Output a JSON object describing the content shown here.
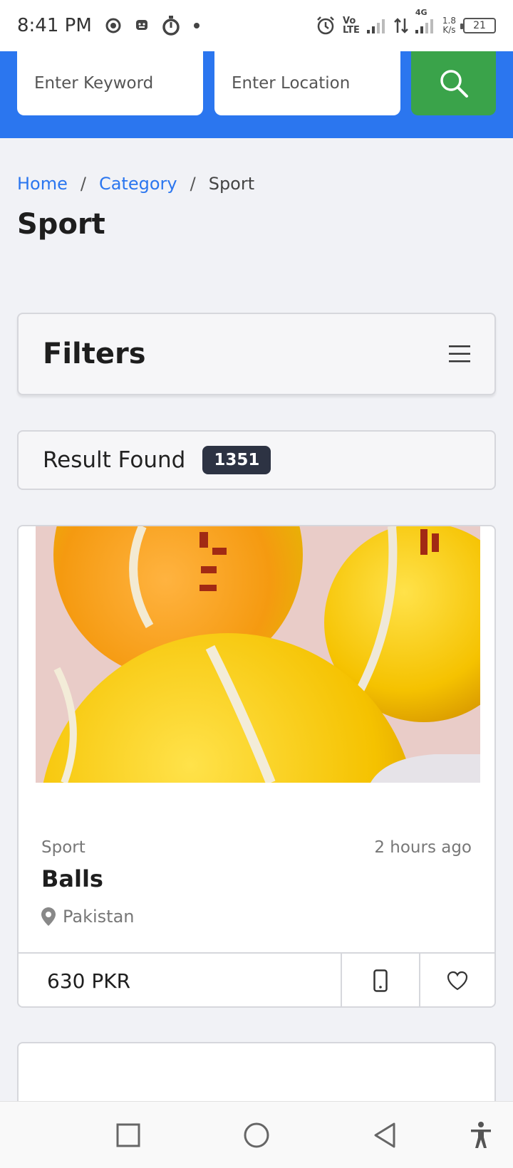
{
  "status_bar": {
    "time": "8:41 PM",
    "battery": "21",
    "net_speed_value": "1.8",
    "net_speed_unit": "K/s",
    "network": "4G",
    "volte_top": "Vo",
    "volte_bottom": "LTE"
  },
  "search": {
    "keyword_placeholder": "Enter Keyword",
    "location_placeholder": "Enter Location",
    "button_icon": "search-icon"
  },
  "breadcrumb": {
    "home": "Home",
    "separator": "/",
    "category": "Category",
    "current": "Sport"
  },
  "page": {
    "title": "Sport"
  },
  "filters": {
    "title": "Filters",
    "icon": "menu-icon"
  },
  "results": {
    "label": "Result Found",
    "count": "1351"
  },
  "listing": {
    "category": "Sport",
    "time_ago": "2 hours ago",
    "title": "Balls",
    "location": "Pakistan",
    "price": "630 PKR"
  },
  "colors": {
    "header_blue": "#2b76ef",
    "search_green": "#3aa34a",
    "badge_dark": "#2d3343"
  }
}
